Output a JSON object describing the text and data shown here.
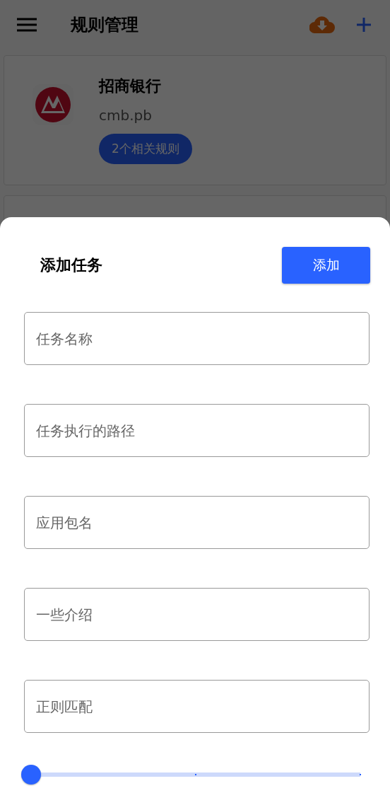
{
  "app_bar": {
    "title": "规则管理"
  },
  "rules": [
    {
      "name": "招商银行",
      "package": "cmb.pb",
      "badge": "2个相关规则",
      "kind": "full"
    },
    {
      "kind": "partial"
    }
  ],
  "sheet": {
    "title": "添加任务",
    "add_button": "添加",
    "fields": [
      {
        "placeholder": "任务名称"
      },
      {
        "placeholder": "任务执行的路径"
      },
      {
        "placeholder": "应用包名"
      },
      {
        "placeholder": "一些介绍"
      },
      {
        "placeholder": "正则匹配"
      }
    ],
    "slider": {
      "level": 0
    }
  }
}
